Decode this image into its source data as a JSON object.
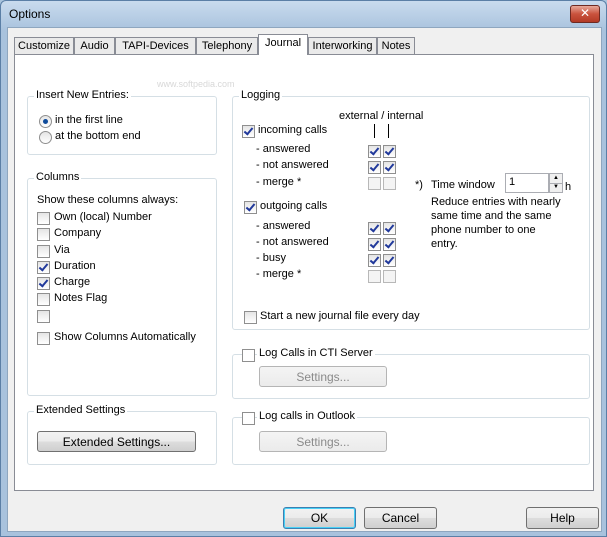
{
  "window": {
    "title": "Options",
    "close_glyph": "✕"
  },
  "tabs": [
    "Customize",
    "Audio",
    "TAPI-Devices",
    "Telephony",
    "Journal",
    "Interworking",
    "Notes"
  ],
  "active_tab": "Journal",
  "insert_new_entries": {
    "title": "Insert New Entries:",
    "options": [
      {
        "label": "in the first line",
        "selected": true
      },
      {
        "label": "at the bottom end",
        "selected": false
      }
    ]
  },
  "columns": {
    "title": "Columns",
    "subtitle": "Show these columns always:",
    "items": [
      {
        "label": "Own (local) Number",
        "checked": false
      },
      {
        "label": "Company",
        "checked": false
      },
      {
        "label": "Via",
        "checked": false
      },
      {
        "label": "Duration",
        "checked": true
      },
      {
        "label": "Charge",
        "checked": true
      },
      {
        "label": "Notes Flag",
        "checked": false
      },
      {
        "label": "",
        "checked": false
      }
    ],
    "auto_label": "Show Columns Automatically",
    "auto_checked": false
  },
  "extended": {
    "title": "Extended Settings",
    "button": "Extended Settings..."
  },
  "logging": {
    "title": "Logging",
    "header": "external / internal",
    "incoming": {
      "label": "incoming calls",
      "checked": true,
      "rows": [
        {
          "label": "- answered",
          "external": true,
          "internal": true
        },
        {
          "label": "- not answered",
          "external": true,
          "internal": true
        },
        {
          "label": "- merge *",
          "external": false,
          "internal": false
        }
      ]
    },
    "outgoing": {
      "label": "outgoing calls",
      "checked": true,
      "rows": [
        {
          "label": "- answered",
          "external": true,
          "internal": true
        },
        {
          "label": "- not answered",
          "external": true,
          "internal": true
        },
        {
          "label": "- busy",
          "external": true,
          "internal": true
        },
        {
          "label": "- merge *",
          "external": false,
          "internal": false
        }
      ]
    },
    "time_window": {
      "marker": "*)",
      "label": "Time window",
      "value": "1",
      "unit": "h"
    },
    "note": [
      "Reduce entries with nearly",
      "same time and the same",
      "phone number to one",
      "entry."
    ],
    "new_file": {
      "label": "Start a new journal file every day",
      "checked": false
    }
  },
  "cti": {
    "label": "Log Calls in CTI Server",
    "checked": false,
    "button": "Settings..."
  },
  "outlook": {
    "label": "Log calls in Outlook",
    "checked": false,
    "button": "Settings..."
  },
  "footer": {
    "ok": "OK",
    "cancel": "Cancel",
    "help": "Help"
  },
  "watermark": "www.softpedia.com"
}
